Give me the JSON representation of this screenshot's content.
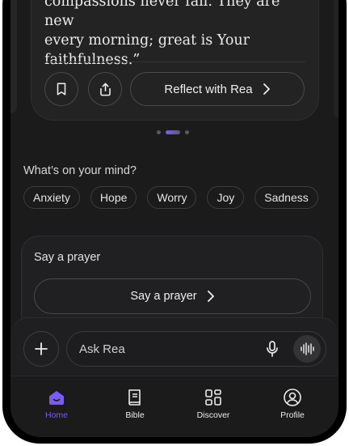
{
  "verse": {
    "lines": [
      "compassions never fail. They are new",
      "every morning; great is Your",
      "faithfulness.”"
    ]
  },
  "actions": {
    "bookmark_icon": "bookmark-icon",
    "share_icon": "share-icon",
    "reflect_label": "Reflect with Rea"
  },
  "carousel": {
    "count": 3,
    "active": 1
  },
  "mind": {
    "title": "What’s on your mind?",
    "chips": [
      "Anxiety",
      "Hope",
      "Worry",
      "Joy",
      "Sadness"
    ]
  },
  "prayer": {
    "title": "Say a prayer",
    "button_label": "Say a prayer"
  },
  "composer": {
    "placeholder": "Ask Rea",
    "plus_icon": "plus-icon",
    "mic_icon": "microphone-icon",
    "voice_icon": "voice-wave-icon"
  },
  "tabs": [
    {
      "label": "Home",
      "icon": "home-icon",
      "active": true
    },
    {
      "label": "Bible",
      "icon": "book-icon",
      "active": false
    },
    {
      "label": "Discover",
      "icon": "grid-icon",
      "active": false
    },
    {
      "label": "Profile",
      "icon": "profile-icon",
      "active": false
    }
  ],
  "colors": {
    "accent": "#7a5cf2",
    "background": "#1b1b1c"
  }
}
